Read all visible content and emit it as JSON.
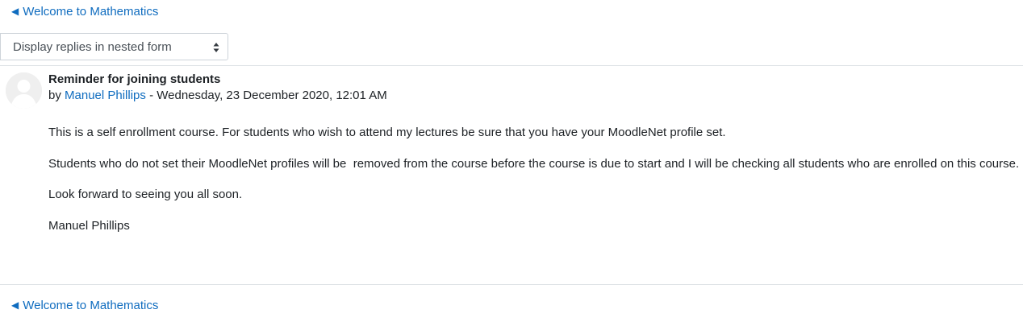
{
  "navigation": {
    "back_link_label": "Welcome to Mathematics",
    "arrow_icon": "triangle-left-icon"
  },
  "display_mode": {
    "selected": "Display replies in nested form"
  },
  "post": {
    "subject": "Reminder for joining students",
    "by_prefix": "by",
    "author": "Manuel Phillips",
    "separator": " - ",
    "date": "Wednesday, 23 December 2020, 12:01 AM",
    "paragraphs": [
      "This is a self enrollment course. For students who wish to attend my lectures be sure that you have your MoodleNet profile set.",
      "Students who do not set their MoodleNet profiles will be  removed from the course before the course is due to start and I will be checking all students who are enrolled on this course.",
      "Look forward to seeing you all soon.",
      "Manuel Phillips"
    ]
  },
  "colors": {
    "link": "#0f6cbf",
    "text": "#1d2125",
    "border": "#dee2e6"
  }
}
